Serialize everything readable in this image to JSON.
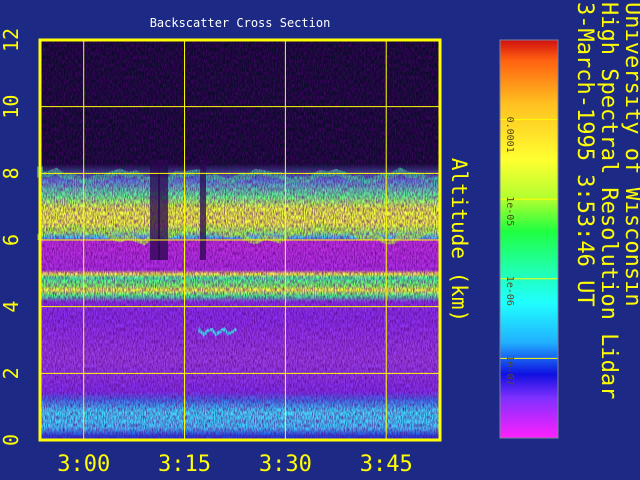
{
  "chart_data": {
    "type": "heatmap",
    "title": "Backscatter Cross Section",
    "ylabel": "Altitude (km)",
    "x_tick_labels": [
      "3:00",
      "3:15",
      "3:30",
      "3:45"
    ],
    "x_ticks_minutes": [
      180,
      195,
      210,
      225
    ],
    "xlim_minutes": [
      173.5,
      233
    ],
    "y_ticks": [
      0,
      2,
      4,
      6,
      8,
      10,
      12
    ],
    "ylim": [
      0,
      12
    ],
    "grid": true,
    "colorbar": {
      "tick_labels": [
        "0.0001",
        "1e-05",
        "1e-06",
        "1e-07"
      ],
      "tick_values": [
        0.0001,
        1e-05,
        1e-06,
        1e-07
      ],
      "range": [
        1e-08,
        0.001
      ],
      "scale": "log"
    },
    "side_text": [
      "University of Wisconsin",
      "High Spectral Resolution Lidar",
      "3-March-1995   3:53:46 UT"
    ],
    "colors": {
      "background": "#1c2a86",
      "frame": "#ffff00",
      "text": "#ffff00",
      "title_text": "#ffffff"
    },
    "layers": [
      {
        "name": "clear air above cloud",
        "base_km": 8.2,
        "top_km": 12,
        "level": "below 1e-07"
      },
      {
        "name": "cloud layer",
        "base_km": 6.0,
        "top_km": 8.2,
        "level": "1e-05"
      },
      {
        "name": "thin layer",
        "base_km": 4.1,
        "top_km": 5.1,
        "level": "1e-05"
      },
      {
        "name": "mid troposphere",
        "base_km": 1.2,
        "top_km": 4.0,
        "level": "1e-07"
      },
      {
        "name": "boundary layer",
        "base_km": 0.1,
        "top_km": 1.2,
        "level": "1e-06"
      }
    ]
  }
}
